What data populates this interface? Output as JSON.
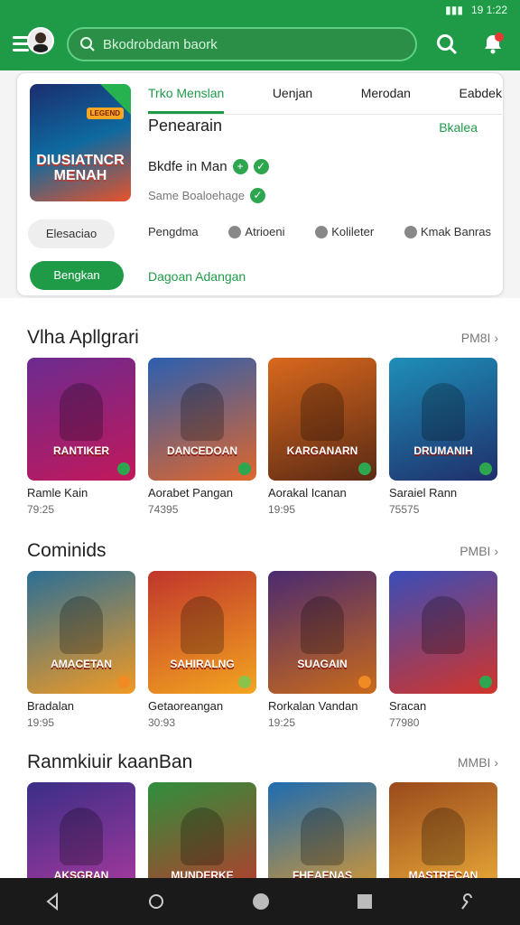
{
  "status": {
    "time": "19 1:22"
  },
  "search": {
    "placeholder": "Bkodrobdam baork"
  },
  "feature": {
    "tabs": [
      "Trko Menslan",
      "Uenjan",
      "Merodan",
      "Eabdek"
    ],
    "title": "Penearain",
    "status": "Bkalea",
    "cover_text": "DIUSIATNCR MENAH",
    "cover_badge": "LEGEND",
    "subtitle": "Bkdfe in Man",
    "meta": "Same Boaloehage",
    "grey_button": "Elesaciao",
    "chips": [
      "Pengdma",
      "Atrioeni",
      "Kolileter",
      "Kmak Banras"
    ],
    "primary_button": "Bengkan",
    "link": "Dagoan Adangan"
  },
  "sections": [
    {
      "title": "Vlha Apllgrari",
      "more": "PM8I",
      "cards": [
        {
          "name": "Ramle Kain",
          "meta": "79:25",
          "label": "RANTIKER",
          "color": "#6b2b8f"
        },
        {
          "name": "Aorabet Pangan",
          "meta": "74395",
          "label": "DANCEDOAN",
          "color": "#2b5fb0"
        },
        {
          "name": "Aorakal Icanan",
          "meta": "19:95",
          "label": "KARGANARN",
          "color": "#d9681d"
        },
        {
          "name": "Saraiel Rann",
          "meta": "75575",
          "label": "DRUMANIH",
          "color": "#1e8fb8"
        }
      ]
    },
    {
      "title": "Cominids",
      "more": "PMBI",
      "cards": [
        {
          "name": "Bradalan",
          "meta": "19:95",
          "label": "AMACETAN",
          "color": "#2c6f96"
        },
        {
          "name": "Getaoreangan",
          "meta": "30:93",
          "label": "SAHIRALNG",
          "color": "#c0362c"
        },
        {
          "name": "Rorkalan Vandan",
          "meta": "19:25",
          "label": "SUAGAIN",
          "color": "#4a2a70"
        },
        {
          "name": "Sracan",
          "meta": "77980",
          "label": "",
          "color": "#3a4db8"
        }
      ]
    },
    {
      "title": "Ranmkiuir kaanBan",
      "more": "MMBI",
      "cards": [
        {
          "name": "",
          "meta": "",
          "label": "AKSGRAN",
          "color": "#3a2e86"
        },
        {
          "name": "",
          "meta": "",
          "label": "MUNDERKE",
          "color": "#2e8f3c"
        },
        {
          "name": "",
          "meta": "",
          "label": "FHEAENAS",
          "color": "#1e6cb0"
        },
        {
          "name": "",
          "meta": "",
          "label": "MASTRECAN",
          "color": "#9a4a1c"
        }
      ]
    }
  ]
}
